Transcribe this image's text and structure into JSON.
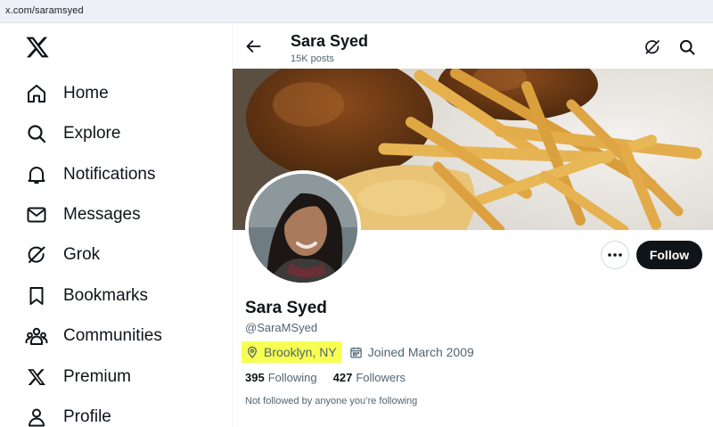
{
  "browser": {
    "url": "x.com/saramsyed"
  },
  "sidebar": {
    "logo_icon": "x-logo-icon",
    "items": [
      {
        "label": "Home",
        "icon": "home-icon"
      },
      {
        "label": "Explore",
        "icon": "search-icon"
      },
      {
        "label": "Notifications",
        "icon": "bell-icon"
      },
      {
        "label": "Messages",
        "icon": "mail-icon"
      },
      {
        "label": "Grok",
        "icon": "grok-icon"
      },
      {
        "label": "Bookmarks",
        "icon": "bookmark-icon"
      },
      {
        "label": "Communities",
        "icon": "communities-icon"
      },
      {
        "label": "Premium",
        "icon": "x-icon"
      },
      {
        "label": "Profile",
        "icon": "profile-icon"
      }
    ]
  },
  "header": {
    "name": "Sara Syed",
    "posts": "15K posts"
  },
  "profile": {
    "name": "Sara Syed",
    "handle": "@SaraMSyed",
    "location": "Brooklyn, NY",
    "joined": "Joined March 2009",
    "following_count": "395",
    "following_label": "Following",
    "followers_count": "427",
    "followers_label": "Followers",
    "followed_by": "Not followed by anyone you’re following"
  },
  "actions": {
    "follow_label": "Follow"
  },
  "colors": {
    "highlight": "#f6ff52",
    "text": "#0f1419",
    "secondary": "#536471",
    "follow_bg": "#0f1419"
  }
}
